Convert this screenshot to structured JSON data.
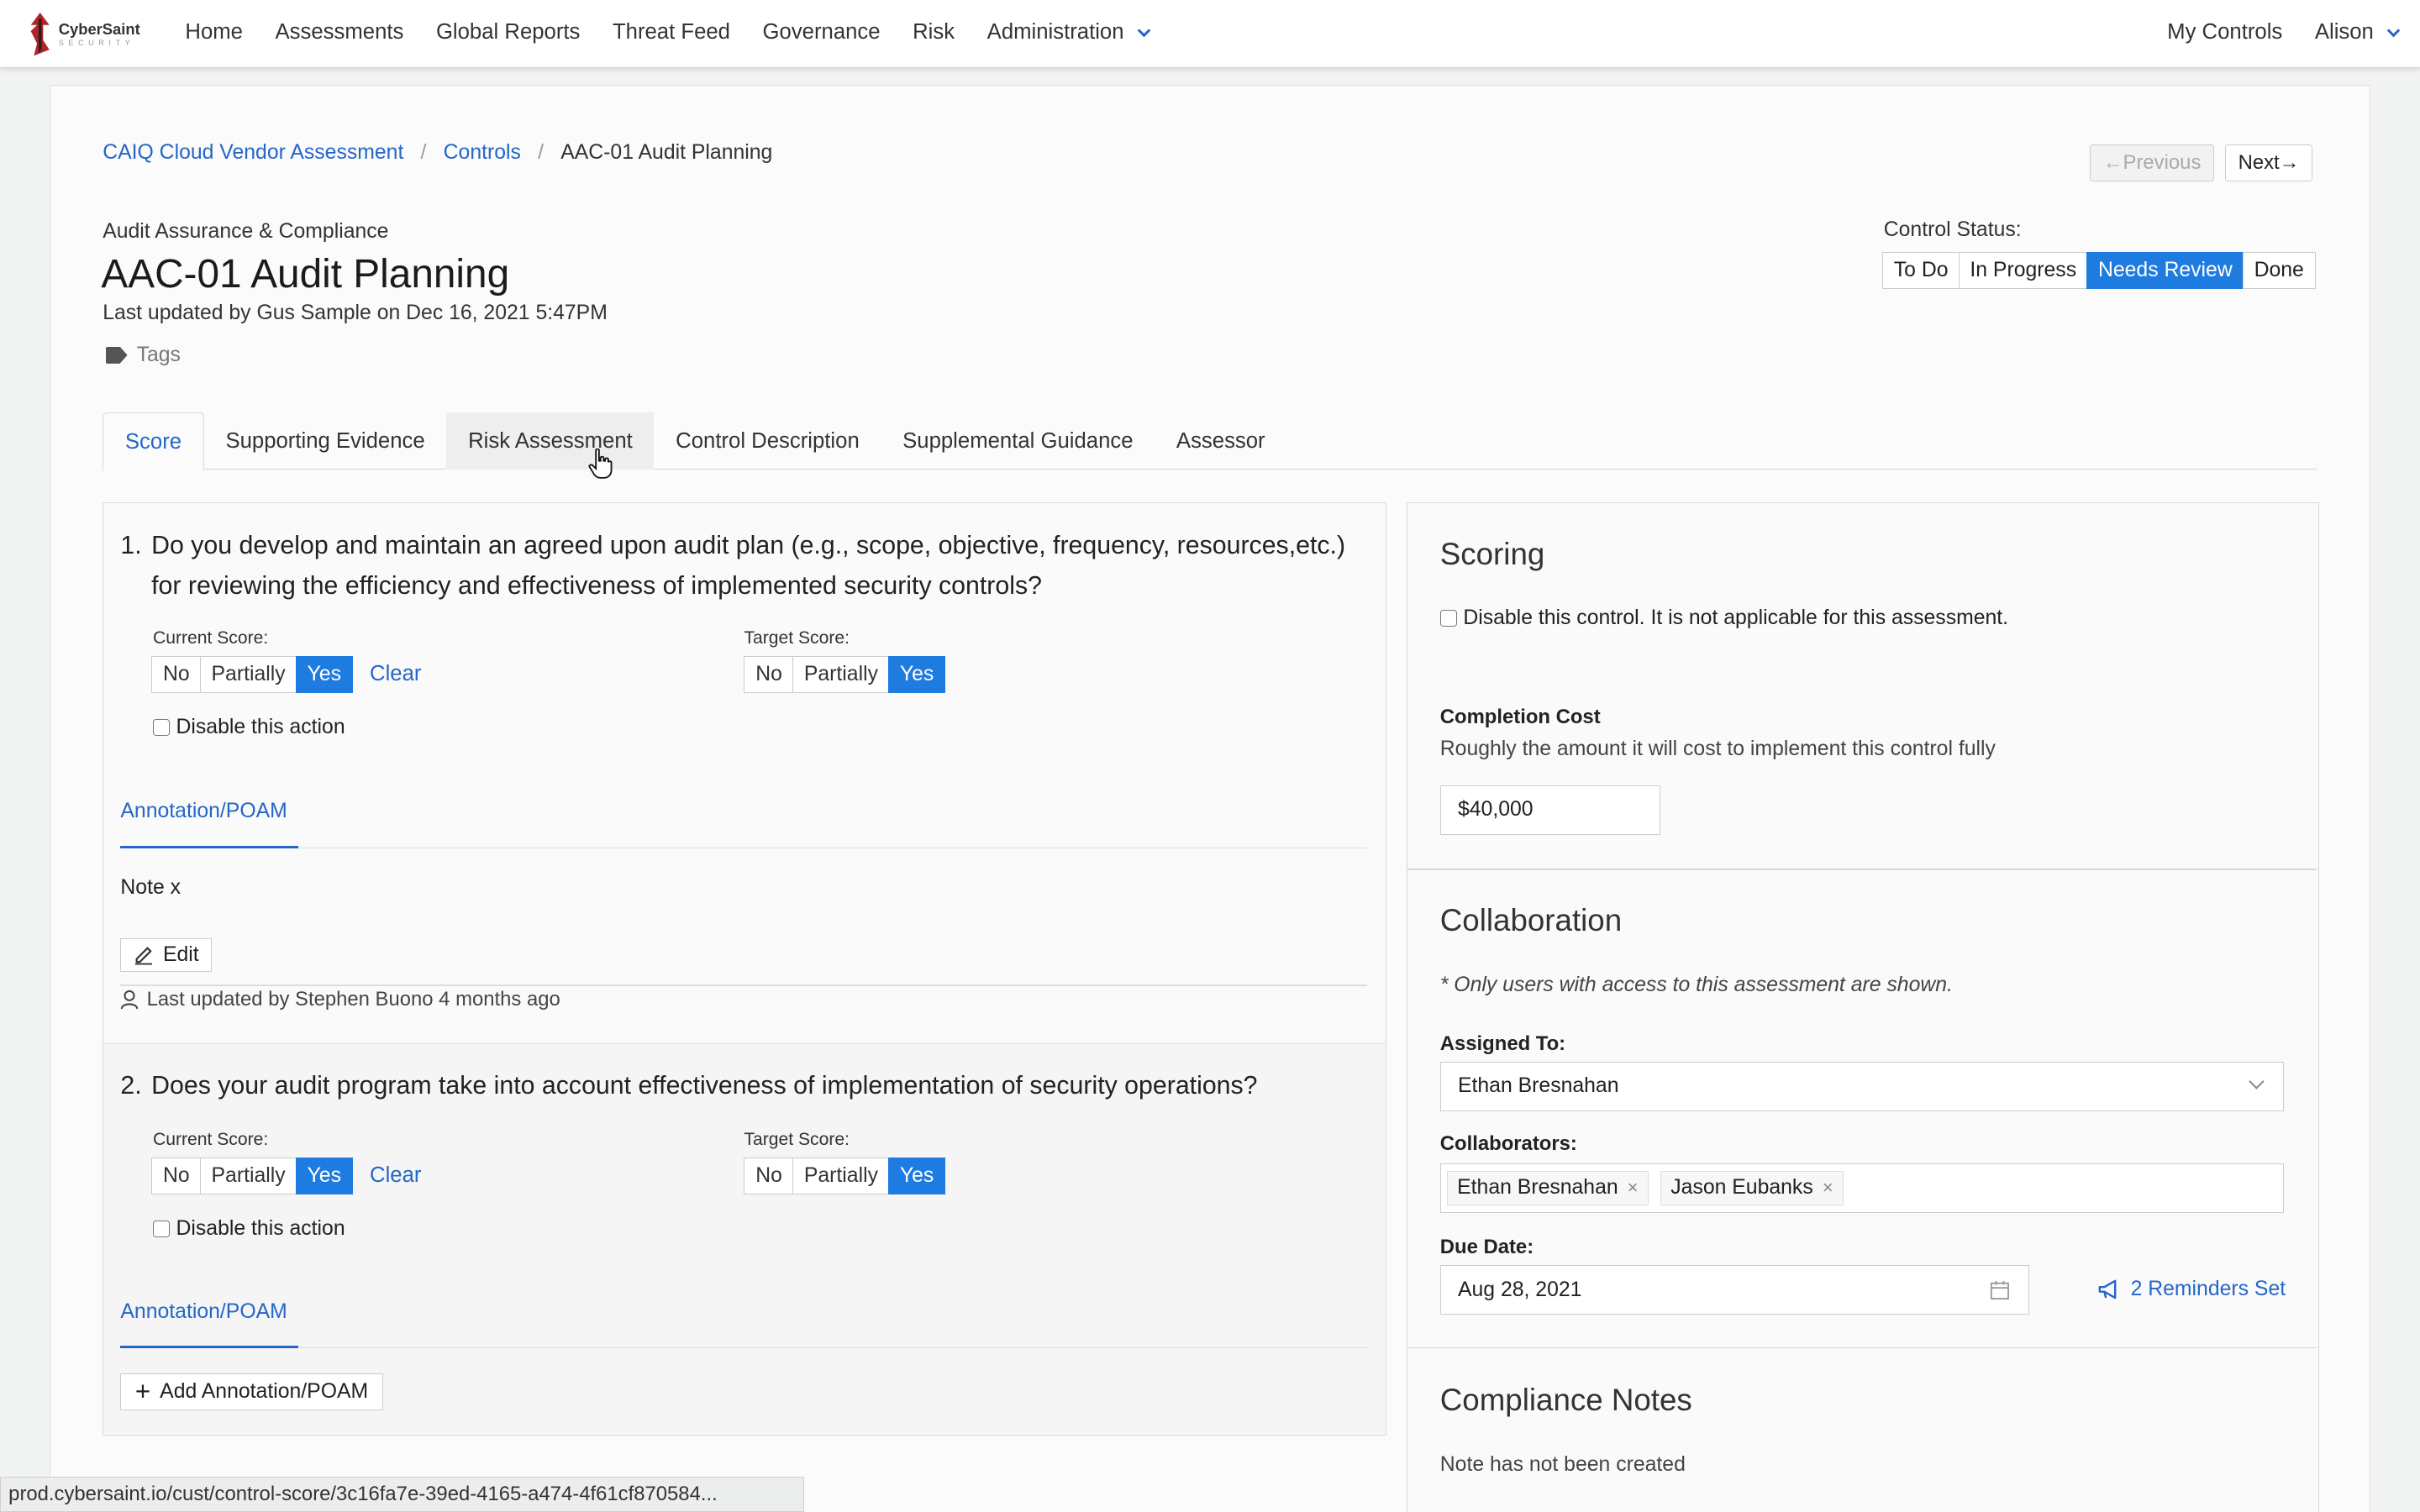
{
  "brand": {
    "name": "CyberSaint",
    "sub": "SECURITY"
  },
  "nav": {
    "links": [
      "Home",
      "Assessments",
      "Global Reports",
      "Threat Feed",
      "Governance",
      "Risk",
      "Administration"
    ],
    "my_controls": "My Controls",
    "user": "Alison"
  },
  "breadcrumb": {
    "assessment": "CAIQ Cloud Vendor Assessment",
    "controls": "Controls",
    "current": "AAC-01 Audit Planning"
  },
  "pager": {
    "previous": "Previous",
    "next": "Next"
  },
  "control": {
    "category": "Audit Assurance & Compliance",
    "title": "AAC-01 Audit Planning",
    "updated": "Last updated by Gus Sample on Dec 16, 2021 5:47PM",
    "tags": "Tags"
  },
  "status": {
    "label": "Control Status:",
    "options": [
      "To Do",
      "In Progress",
      "Needs Review",
      "Done"
    ],
    "selected": "Needs Review"
  },
  "tabs": [
    "Score",
    "Supporting Evidence",
    "Risk Assessment",
    "Control Description",
    "Supplemental Guidance",
    "Assessor"
  ],
  "questions": [
    {
      "number": "1.",
      "text": "Do you develop and maintain an agreed upon audit plan (e.g., scope, objective, frequency, resources,etc.) for reviewing the efficiency and effectiveness of implemented security controls?",
      "current_label": "Current Score:",
      "target_label": "Target Score:",
      "options": [
        "No",
        "Partially",
        "Yes"
      ],
      "current": "Yes",
      "target": "Yes",
      "clear": "Clear",
      "disable": "Disable this action",
      "annotation_tab": "Annotation/POAM",
      "note": "Note x",
      "edit": "Edit",
      "last_updated": "Last updated by Stephen Buono 4 months ago"
    },
    {
      "number": "2.",
      "text": "Does your audit program take into account effectiveness of implementation of security operations?",
      "current_label": "Current Score:",
      "target_label": "Target Score:",
      "options": [
        "No",
        "Partially",
        "Yes"
      ],
      "current": "Yes",
      "target": "Yes",
      "clear": "Clear",
      "disable": "Disable this action",
      "annotation_tab": "Annotation/POAM",
      "add_annotation": "Add Annotation/POAM"
    }
  ],
  "scoring": {
    "title": "Scoring",
    "disable_control": "Disable this control. It is not applicable for this assessment.",
    "cost_label": "Completion Cost",
    "cost_help": "Roughly the amount it will cost to implement this control fully",
    "cost_value": "$40,000"
  },
  "collaboration": {
    "title": "Collaboration",
    "note": "* Only users with access to this assessment are shown.",
    "assigned_label": "Assigned To:",
    "assigned_value": "Ethan Bresnahan",
    "collaborators_label": "Collaborators:",
    "collaborators": [
      "Ethan Bresnahan",
      "Jason Eubanks"
    ],
    "due_label": "Due Date:",
    "due_value": "Aug 28, 2021",
    "reminders": "2 Reminders Set"
  },
  "compliance": {
    "title": "Compliance Notes",
    "empty": "Note has not been created"
  },
  "statusbar": "prod.cybersaint.io/cust/control-score/3c16fa7e-39ed-4165-a474-4f61cf870584..."
}
